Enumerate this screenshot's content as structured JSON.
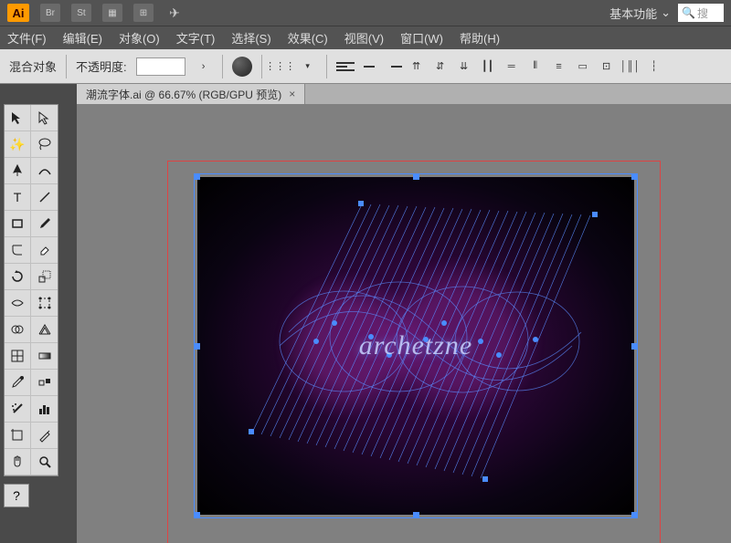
{
  "topbar": {
    "logo": "Ai",
    "icons": [
      "Br",
      "St",
      "grid",
      "arrange",
      "rocket"
    ],
    "workspace": "基本功能",
    "search_placeholder": "搜"
  },
  "menu": {
    "file": "文件(F)",
    "edit": "编辑(E)",
    "object": "对象(O)",
    "type": "文字(T)",
    "select": "选择(S)",
    "effect": "效果(C)",
    "view": "视图(V)",
    "window": "窗口(W)",
    "help": "帮助(H)"
  },
  "controlbar": {
    "selection_label": "混合对象",
    "opacity_label": "不透明度:",
    "opacity_value": ""
  },
  "document": {
    "tab_title": "潮流字体.ai @ 66.67% (RGB/GPU 预览)"
  },
  "artwork": {
    "text": "archetzne"
  },
  "tools": {
    "names": [
      "selection-tool",
      "direct-selection-tool",
      "magic-wand-tool",
      "lasso-tool",
      "pen-tool",
      "curvature-tool",
      "type-tool",
      "line-tool",
      "rectangle-tool",
      "paintbrush-tool",
      "shaper-tool",
      "eraser-tool",
      "rotate-tool",
      "scale-tool",
      "width-tool",
      "free-transform-tool",
      "shape-builder-tool",
      "perspective-grid-tool",
      "mesh-tool",
      "gradient-tool",
      "eyedropper-tool",
      "blend-tool",
      "symbol-sprayer-tool",
      "column-graph-tool",
      "artboard-tool",
      "slice-tool",
      "hand-tool",
      "zoom-tool"
    ]
  }
}
